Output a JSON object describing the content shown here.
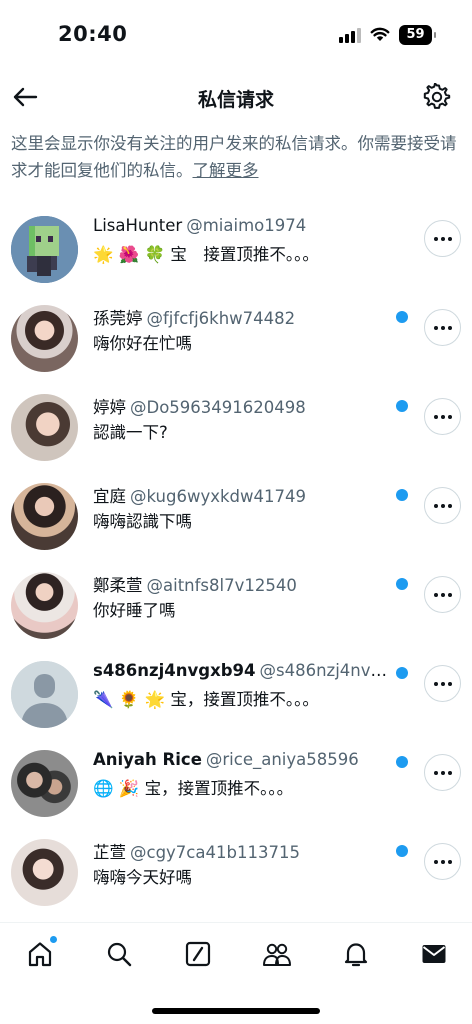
{
  "status_bar": {
    "time": "20:40",
    "battery": "59"
  },
  "header": {
    "title": "私信请求",
    "back_icon": "arrow-left-icon",
    "settings_icon": "gear-icon"
  },
  "notice": {
    "text": "这里会显示你没有关注的用户发来的私信请求。你需要接受请求才能回复他们的私信。",
    "link": "了解更多"
  },
  "requests": [
    {
      "name": "LisaHunter",
      "handle": "@miaimo1974",
      "bold": false,
      "message": "🌟 🌺 🍀 宝　接置顶推不。。。",
      "unread": false,
      "avatar": "green-robot"
    },
    {
      "name": "孫莞婷",
      "handle": "@fjfcfj6khw74482",
      "bold": false,
      "message": "嗨你好在忙嗎",
      "unread": true,
      "avatar": "photo-woman"
    },
    {
      "name": "婷婷",
      "handle": "@Do5963491620498",
      "bold": false,
      "message": "認識一下?",
      "unread": true,
      "avatar": "photo-woman"
    },
    {
      "name": "宜庭",
      "handle": "@kug6wyxkdw41749",
      "bold": false,
      "message": "嗨嗨認識下嗎",
      "unread": true,
      "avatar": "photo-woman"
    },
    {
      "name": "鄭柔萱",
      "handle": "@aitnfs8l7v12540",
      "bold": false,
      "message": "你好睡了嗎",
      "unread": true,
      "avatar": "photo-woman"
    },
    {
      "name": "s486nzj4nvgxb94",
      "handle": "@s486nzj4nv5...",
      "bold": true,
      "message": "🌂 🌻 🌟 宝，接置顶推不。。。",
      "unread": true,
      "avatar": "default"
    },
    {
      "name": "Aniyah Rice",
      "handle": "@rice_aniya58596",
      "bold": true,
      "message": "🌐 🎉 宝，接置顶推不。。。",
      "unread": true,
      "avatar": "photo-couple"
    },
    {
      "name": "芷萱",
      "handle": "@cgy7ca41b113715",
      "bold": false,
      "message": "嗨嗨今天好嗎",
      "unread": true,
      "avatar": "photo-woman"
    }
  ],
  "tabbar": {
    "items": [
      "home-icon",
      "search-icon",
      "grok-icon",
      "communities-icon",
      "bell-icon",
      "mail-icon"
    ],
    "home_has_dot": true
  },
  "colors": {
    "accent": "#1d9bf0",
    "text": "#0f1419",
    "secondary": "#536471"
  }
}
